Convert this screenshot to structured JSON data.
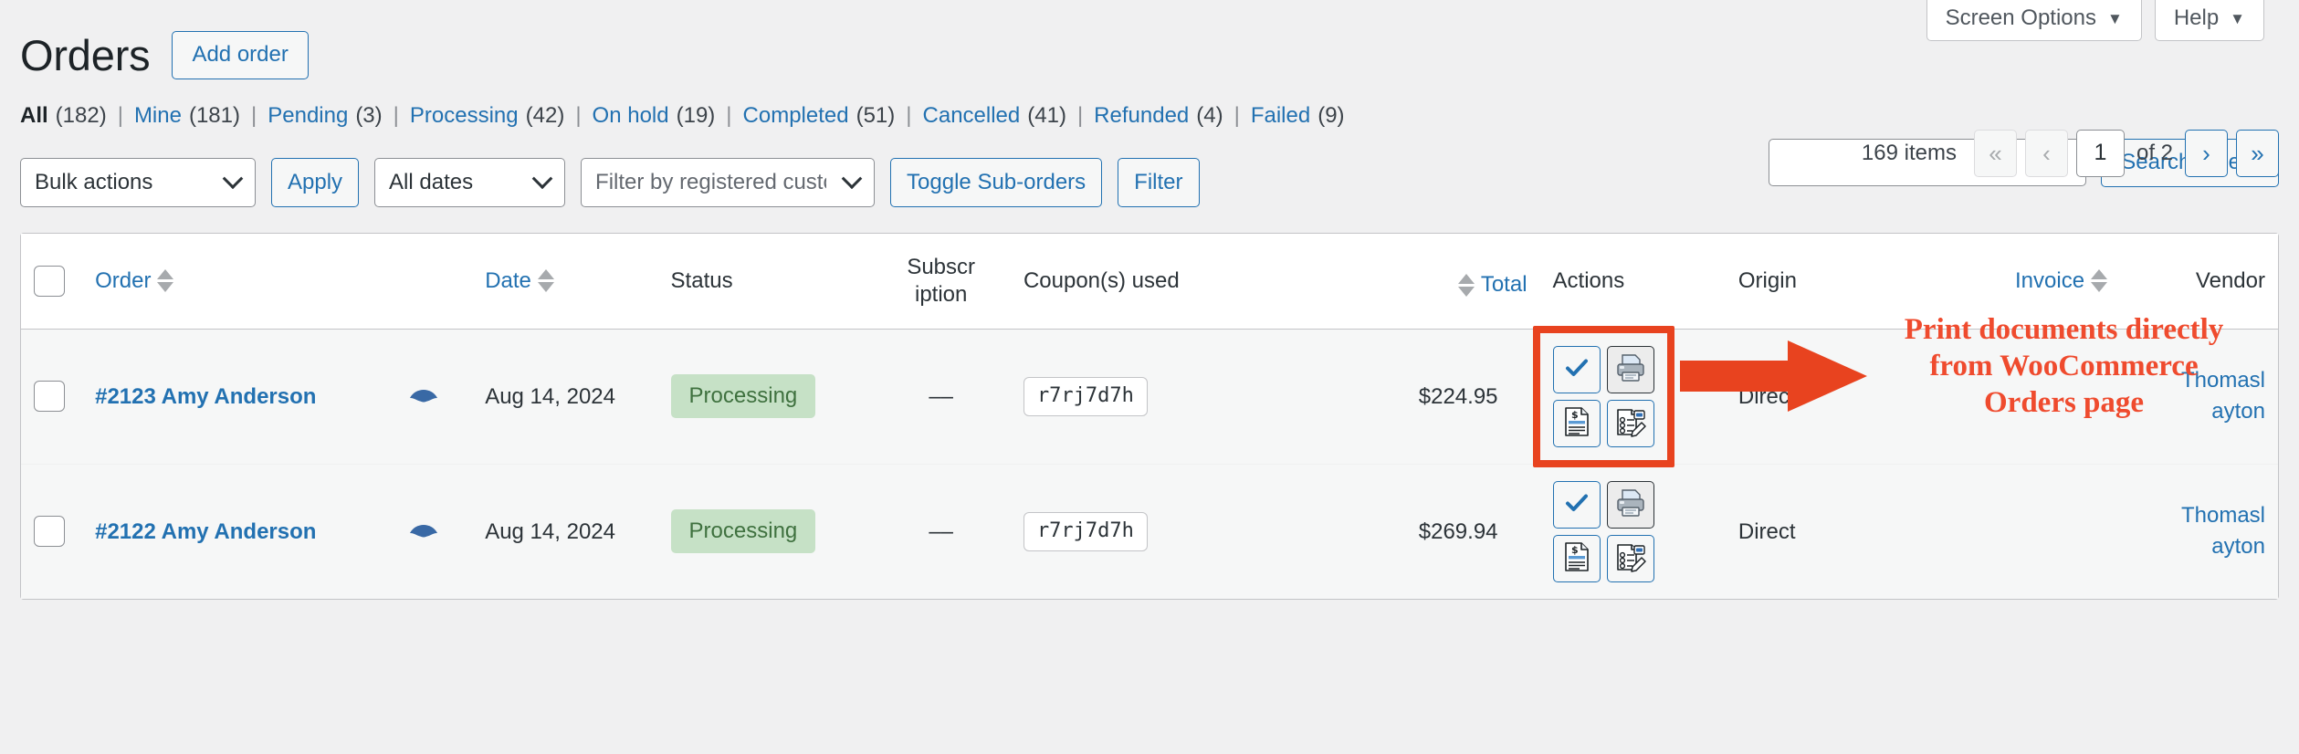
{
  "screen_meta": {
    "screen_options_label": "Screen Options",
    "help_label": "Help",
    "caret": "▼"
  },
  "header": {
    "title": "Orders",
    "add_order_label": "Add order"
  },
  "status_links": [
    {
      "label": "All",
      "count": "(182)",
      "current": true
    },
    {
      "label": "Mine",
      "count": "(181)",
      "current": false
    },
    {
      "label": "Pending",
      "count": "(3)",
      "current": false
    },
    {
      "label": "Processing",
      "count": "(42)",
      "current": false
    },
    {
      "label": "On hold",
      "count": "(19)",
      "current": false
    },
    {
      "label": "Completed",
      "count": "(51)",
      "current": false
    },
    {
      "label": "Cancelled",
      "count": "(41)",
      "current": false
    },
    {
      "label": "Refunded",
      "count": "(4)",
      "current": false
    },
    {
      "label": "Failed",
      "count": "(9)",
      "current": false
    }
  ],
  "separator": "|",
  "search": {
    "value": "",
    "placeholder": "",
    "button_label": "Search orders"
  },
  "toolbar": {
    "bulk_actions_value": "Bulk actions",
    "apply_label": "Apply",
    "all_dates_value": "All dates",
    "customer_placeholder": "Filter by registered customer",
    "toggle_suborders_label": "Toggle Sub-orders",
    "filter_label": "Filter"
  },
  "pagination": {
    "items_text": "169 items",
    "first_label": "«",
    "prev_label": "‹",
    "current_page": "1",
    "of_text": "of 2",
    "next_label": "›",
    "last_label": "»"
  },
  "table": {
    "columns": [
      {
        "key": "cb",
        "label": "",
        "sortable": false,
        "link": false,
        "align": "left"
      },
      {
        "key": "order",
        "label": "Order",
        "sortable": true,
        "link": true,
        "align": "left"
      },
      {
        "key": "date",
        "label": "Date",
        "sortable": true,
        "link": true,
        "align": "left"
      },
      {
        "key": "status",
        "label": "Status",
        "sortable": false,
        "link": false,
        "align": "left"
      },
      {
        "key": "sub",
        "label": "Subscr iption",
        "sortable": false,
        "link": false,
        "align": "center"
      },
      {
        "key": "coupon",
        "label": "Coupon(s) used",
        "sortable": false,
        "link": false,
        "align": "left"
      },
      {
        "key": "total",
        "label": "Total",
        "sortable": true,
        "link": true,
        "align": "right"
      },
      {
        "key": "actions",
        "label": "Actions",
        "sortable": false,
        "link": false,
        "align": "left"
      },
      {
        "key": "origin",
        "label": "Origin",
        "sortable": false,
        "link": false,
        "align": "left"
      },
      {
        "key": "invoice",
        "label": "Invoice",
        "sortable": true,
        "link": true,
        "align": "right"
      },
      {
        "key": "vendor",
        "label": "Vendor",
        "sortable": false,
        "link": false,
        "align": "right"
      }
    ],
    "rows": [
      {
        "order": "#2123 Amy Anderson",
        "date": "Aug 14, 2024",
        "status": "Processing",
        "subscription": "––",
        "coupon": "r7rj7d7h",
        "total": "$224.95",
        "origin": "Direct",
        "invoice": "",
        "vendor_line1": "Thomasl",
        "vendor_line2": "ayton",
        "actions": [
          {
            "name": "complete-order-icon",
            "title": "Complete"
          },
          {
            "name": "printer-icon",
            "title": "Print"
          },
          {
            "name": "invoice-doc-icon",
            "title": "Invoice"
          },
          {
            "name": "packing-slip-icon",
            "title": "Packing slip"
          }
        ]
      },
      {
        "order": "#2122 Amy Anderson",
        "date": "Aug 14, 2024",
        "status": "Processing",
        "subscription": "––",
        "coupon": "r7rj7d7h",
        "total": "$269.94",
        "origin": "Direct",
        "invoice": "",
        "vendor_line1": "Thomasl",
        "vendor_line2": "ayton",
        "actions": [
          {
            "name": "complete-order-icon",
            "title": "Complete"
          },
          {
            "name": "printer-icon",
            "title": "Print"
          },
          {
            "name": "invoice-doc-icon",
            "title": "Invoice"
          },
          {
            "name": "packing-slip-icon",
            "title": "Packing slip"
          }
        ]
      }
    ]
  },
  "annotation": {
    "text_line1": "Print documents directly",
    "text_line2": "from WooCommerce",
    "text_line3": "Orders page",
    "color": "#ef4b2e",
    "highlight_color": "#e8431f"
  },
  "colors": {
    "accent_blue": "#2271b1",
    "status_green_bg": "#c6e1c6",
    "status_green_text": "#3f713f",
    "page_bg": "#f0f0f1",
    "row_bg": "#f6f7f7"
  }
}
